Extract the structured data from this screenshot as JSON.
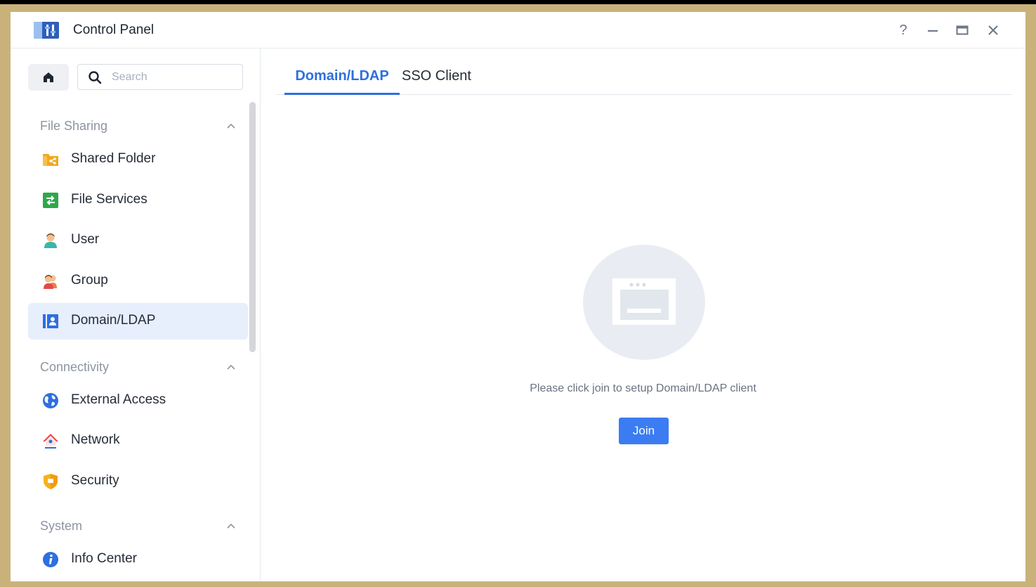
{
  "window": {
    "title": "Control Panel",
    "controls": {
      "help": "?",
      "minimize": "—",
      "maximize": "▭",
      "close": "✕"
    }
  },
  "sidebar": {
    "search": {
      "placeholder": "Search",
      "value": ""
    },
    "groups": [
      {
        "label": "File Sharing",
        "items": [
          {
            "label": "Shared Folder",
            "icon": "shared-folder-icon"
          },
          {
            "label": "File Services",
            "icon": "file-services-icon"
          },
          {
            "label": "User",
            "icon": "user-icon"
          },
          {
            "label": "Group",
            "icon": "group-icon"
          },
          {
            "label": "Domain/LDAP",
            "icon": "domain-ldap-icon",
            "active": true
          }
        ]
      },
      {
        "label": "Connectivity",
        "items": [
          {
            "label": "External Access",
            "icon": "globe-icon"
          },
          {
            "label": "Network",
            "icon": "network-icon"
          },
          {
            "label": "Security",
            "icon": "shield-icon"
          }
        ]
      },
      {
        "label": "System",
        "items": [
          {
            "label": "Info Center",
            "icon": "info-icon"
          }
        ]
      }
    ]
  },
  "main": {
    "tabs": [
      {
        "label": "Domain/LDAP",
        "active": true
      },
      {
        "label": "SSO Client",
        "active": false
      }
    ],
    "empty_message": "Please click join to setup Domain/LDAP client",
    "join_label": "Join"
  },
  "colors": {
    "accent": "#3b7cf3",
    "active_tab": "#2d6fe0",
    "active_item_bg": "#e7eefc",
    "frame": "#c9b27a"
  }
}
